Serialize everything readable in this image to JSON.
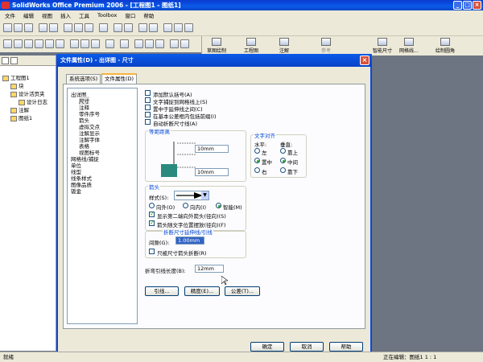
{
  "app": {
    "title": "SolidWorks Office Premium 2006 - [工程图1 - 图纸1]"
  },
  "menu": [
    "文件",
    "编辑",
    "视图",
    "插入",
    "工具",
    "Toolbox",
    "窗口",
    "帮助"
  ],
  "command_manager": {
    "items": [
      "草图绘制",
      "工程图",
      "注解",
      "参考",
      "智能尺寸",
      "网格线...",
      "绘制圆角"
    ]
  },
  "feature_tree": {
    "items": [
      "工程图1",
      "块",
      "设计活页夹",
      "设计日志",
      "注解",
      "图纸1"
    ]
  },
  "dialog": {
    "title": "文件属性(D) - 出详图 - 尺寸",
    "tabs": [
      "系统选项(S)",
      "文件属性(D)"
    ],
    "tree": [
      "出详图",
      "尺寸",
      "注释",
      "零件序号",
      "箭头",
      "虚拟交点",
      "注解显示",
      "注解字体",
      "表格",
      "视图标号",
      "网格线/捕捉",
      "单位",
      "线型",
      "线条样式",
      "图像品质",
      "钣金"
    ],
    "options": {
      "cb1": "添加默认括号(A)",
      "cb2": "文字捕捉到网格线上(S)",
      "cb3": "置中于延伸线之间(C)",
      "cb4": "在基本公差框内包括前缀(I)",
      "cb5": "自动折断尺寸线(A)"
    },
    "spacing": {
      "title": "等距距离",
      "v1": "10mm",
      "v2": "10mm"
    },
    "text_align": {
      "title": "文字对齐",
      "horizontal_label": "水平:",
      "vertical_label": "垂直:",
      "h_left": "左",
      "h_center": "置中",
      "h_right": "右",
      "v_top": "靠上",
      "v_middle": "中间",
      "v_bottom": "靠下"
    },
    "arrows": {
      "title": "箭头",
      "style_label": "样式(S):",
      "r_out": "向外(O)",
      "r_in": "向内(I)",
      "r_smart": "智能(M)",
      "cb_second": "显示第二端向外箭头(径向)(S)",
      "cb_follow": "箭头随文字位置摆放(径向)(F)"
    },
    "break": {
      "title": "折断尺寸延伸线/引线",
      "gap_label": "间隙(G):",
      "gap_value": "1.00mm",
      "cb_only": "只被尺寸箭头折断(R)"
    },
    "leader_len_label": "折弯引线长度(B):",
    "leader_len_value": "12mm",
    "buttons_row": [
      "引线...",
      "精度(E)...",
      "公差(T)..."
    ],
    "bottom_buttons": [
      "确定",
      "取消",
      "帮助"
    ]
  },
  "status": {
    "left": "就绪",
    "right": "正在编辑：图纸1  1 : 1"
  }
}
